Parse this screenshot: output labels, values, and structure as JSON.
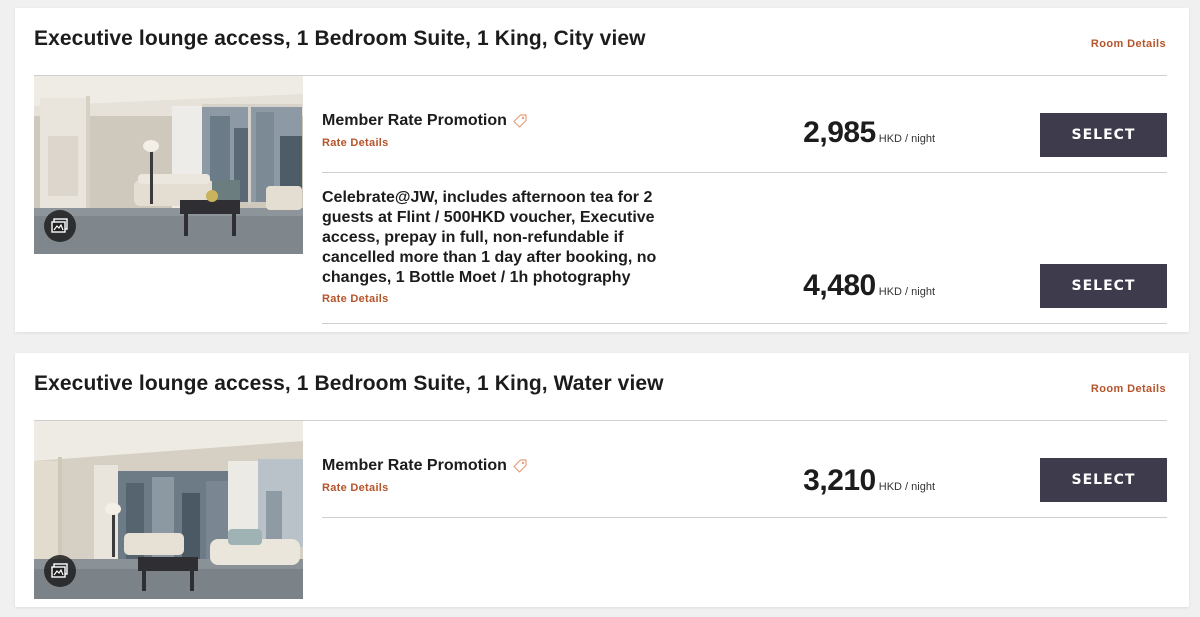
{
  "rooms": [
    {
      "title": "Executive lounge access, 1 Bedroom Suite, 1 King, City view",
      "room_details_label": "Room Details",
      "rates": [
        {
          "name": "Member Rate Promotion",
          "details_label": "Rate Details",
          "price": "2,985",
          "unit": "HKD / night",
          "button_label": "SELECT"
        },
        {
          "name": "Celebrate@JW, includes afternoon tea for 2 guests at Flint / 500HKD voucher, Executive access, prepay in full, non-refundable if cancelled more than 1 day after booking, no changes, 1 Bottle Moet / 1h photography",
          "details_label": "Rate Details",
          "price": "4,480",
          "unit": "HKD / night",
          "button_label": "SELECT"
        }
      ]
    },
    {
      "title": "Executive lounge access, 1 Bedroom Suite, 1 King, Water view",
      "room_details_label": "Room Details",
      "rates": [
        {
          "name": "Member Rate Promotion",
          "details_label": "Rate Details",
          "price": "3,210",
          "unit": "HKD / night",
          "button_label": "SELECT"
        }
      ]
    }
  ],
  "icons": {
    "promo": "tag-icon",
    "gallery": "photo-gallery-icon"
  },
  "colors": {
    "accent_link": "#b5542b",
    "button_bg": "#3d3b4c",
    "button_text": "#ffffff",
    "tag_icon": "#e8a07c"
  }
}
